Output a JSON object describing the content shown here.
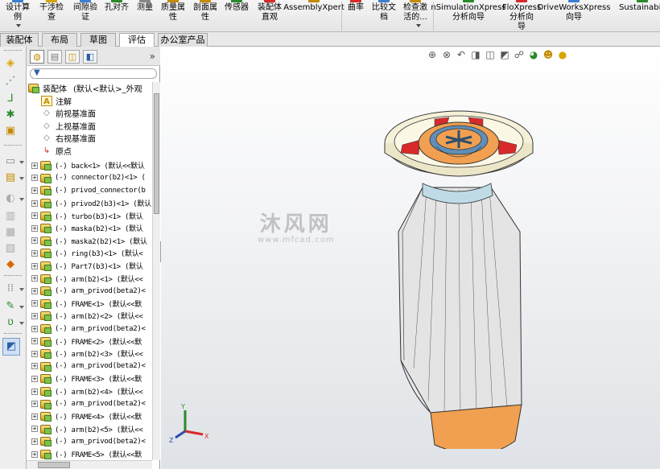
{
  "ribbon": {
    "buttons": [
      {
        "label": "设计算\n例"
      },
      {
        "label": "干涉检\n查"
      },
      {
        "label": "间隙验\n证"
      },
      {
        "label": "孔对齐"
      },
      {
        "label": "测量"
      },
      {
        "label": "质量属\n性"
      },
      {
        "label": "剖面属\n性"
      },
      {
        "label": "传感器"
      },
      {
        "label": "装配体\n直观"
      },
      {
        "label": "AssemblyXpert"
      },
      {
        "label": "曲率"
      },
      {
        "label": "比较文\n档"
      },
      {
        "label": "检查激\n活的..."
      },
      {
        "label": "nSimulationXpress\n分析向导"
      },
      {
        "label": "FloXpress\n分析向\n导"
      },
      {
        "label": "DriveWorksXpress\n向导"
      },
      {
        "label": "Sustainabili"
      }
    ]
  },
  "tabs": [
    {
      "label": "装配体"
    },
    {
      "label": "布局"
    },
    {
      "label": "草图"
    },
    {
      "label": "评估"
    },
    {
      "label": "办公室产品"
    }
  ],
  "active_tab": "评估",
  "feature_manager": {
    "collapse_glyph": "»",
    "filter_icon": "filter-icon",
    "root": {
      "label": "装配体",
      "config": "(默认<默认>_外观"
    },
    "system_items": [
      {
        "label": "注解",
        "icon": "annotations-icon"
      },
      {
        "label": "前视基准面",
        "icon": "plane-icon"
      },
      {
        "label": "上视基准面",
        "icon": "plane-icon"
      },
      {
        "label": "右视基准面",
        "icon": "plane-icon"
      },
      {
        "label": "原点",
        "icon": "origin-icon"
      }
    ],
    "components": [
      {
        "label": "(-) back<1> (默认<<默认"
      },
      {
        "label": "(-) connector(b2)<1> ("
      },
      {
        "label": "(-) privod_connector(b"
      },
      {
        "label": "(-) privod2(b3)<1> (默认"
      },
      {
        "label": "(-) turbo(b3)<1> (默认"
      },
      {
        "label": "(-) maska(b2)<1> (默认"
      },
      {
        "label": "(-) maska2(b2)<1> (默认"
      },
      {
        "label": "(-) ring(b3)<1> (默认<"
      },
      {
        "label": "(-) Part7(b3)<1> (默认"
      },
      {
        "label": "(-) arm(b2)<1> (默认<<"
      },
      {
        "label": "(-) arm_privod(beta2)<"
      },
      {
        "label": "(-) FRAME<1> (默认<<默"
      },
      {
        "label": "(-) arm(b2)<2> (默认<<"
      },
      {
        "label": "(-) arm_privod(beta2)<"
      },
      {
        "label": "(-) FRAME<2> (默认<<默"
      },
      {
        "label": "(-) arm(b2)<3> (默认<<"
      },
      {
        "label": "(-) arm_privod(beta2)<"
      },
      {
        "label": "(-) FRAME<3> (默认<<默"
      },
      {
        "label": "(-) arm(b2)<4> (默认<<"
      },
      {
        "label": "(-) arm_privod(beta2)<"
      },
      {
        "label": "(-) FRAME<4> (默认<<默"
      },
      {
        "label": "(-) arm(b2)<5> (默认<<"
      },
      {
        "label": "(-) arm_privod(beta2)<"
      },
      {
        "label": "(-) FRAME<5> (默认<<默"
      }
    ]
  },
  "viewport": {
    "watermark_cn": "沐风网",
    "watermark_url": "www.mfcad.com",
    "triad": {
      "x": "X",
      "y": "Y",
      "z": "Z"
    }
  },
  "colors": {
    "tab_active_bg": "#ffffff",
    "model_body": "#e2e2e2",
    "model_accent": "#f0a050",
    "model_red": "#d82a2a",
    "model_blue": "#5f8fb8"
  }
}
